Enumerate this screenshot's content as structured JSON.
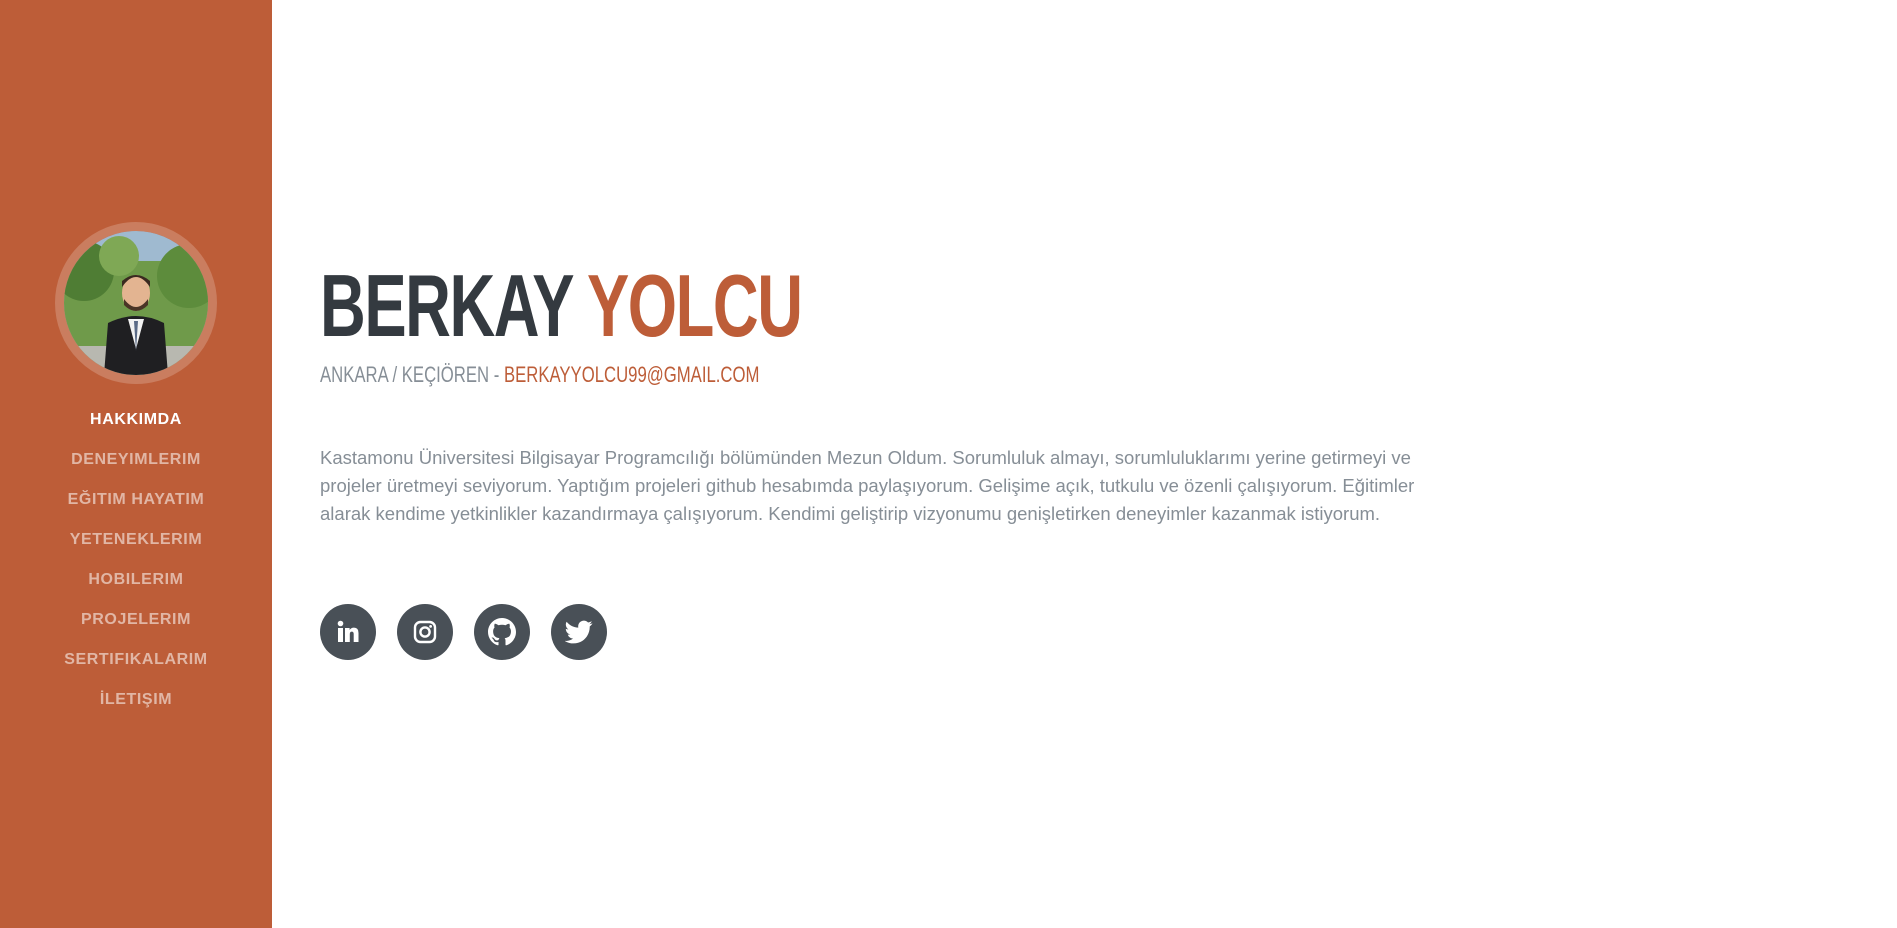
{
  "sidebar": {
    "avatar_alt": "Profile photo",
    "nav": [
      {
        "label": "HAKKIMDA",
        "active": true
      },
      {
        "label": "DENEYIMLERIM",
        "active": false
      },
      {
        "label": "EĞITIM HAYATIM",
        "active": false
      },
      {
        "label": "YETENEKLERIM",
        "active": false
      },
      {
        "label": "HOBILERIM",
        "active": false
      },
      {
        "label": "PROJELERIM",
        "active": false
      },
      {
        "label": "SERTIFIKALARIM",
        "active": false
      },
      {
        "label": "İLETIŞIM",
        "active": false
      }
    ]
  },
  "about": {
    "first_name": "BERKAY",
    "last_name": "YOLCU",
    "location": "ANKARA / KEÇIÖREN - ",
    "email": "BERKAYYOLCU99@GMAIL.COM",
    "bio": "Kastamonu Üniversitesi Bilgisayar Programcılığı bölümünden Mezun Oldum. Sorumluluk almayı, sorumluluklarımı yerine getirmeyi ve projeler üretmeyi seviyorum. Yaptığım projeleri github hesabımda paylaşıyorum. Gelişime açık, tutkulu ve özenli çalışıyorum. Eğitimler alarak kendime yetkinlikler kazandırmaya çalışıyorum. Kendimi geliştirip vizyonumu genişletirken deneyimler kazanmak istiyorum."
  },
  "social": [
    {
      "icon": "linkedin-icon"
    },
    {
      "icon": "instagram-icon"
    },
    {
      "icon": "github-icon"
    },
    {
      "icon": "twitter-icon"
    }
  ],
  "colors": {
    "primary": "#bd5d38",
    "dark": "#343a40",
    "muted": "#868e96",
    "social_bg": "#495057"
  }
}
